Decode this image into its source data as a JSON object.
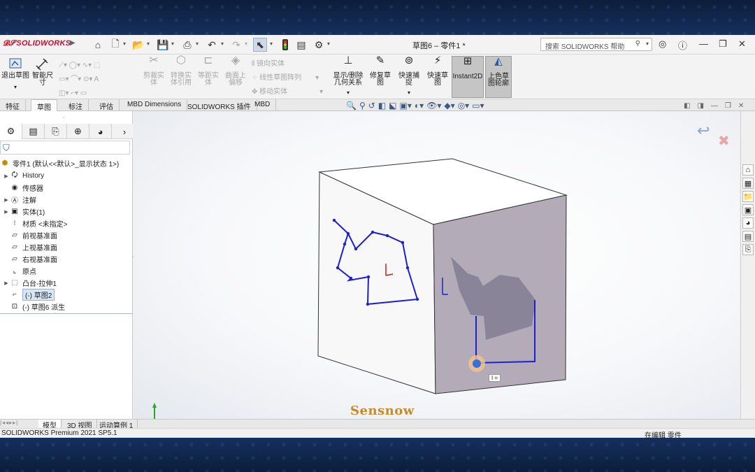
{
  "app": {
    "brand": "SOLIDWORKS",
    "doc_title": "草图6 – 零件1 *",
    "search_placeholder": "搜索 SOLIDWORKS 帮助"
  },
  "ribbon": {
    "exit_sketch": "退出草图",
    "smart_dim": "智能尺寸",
    "trim": "剪裁实体",
    "convert": "转换实体引用",
    "offset": "等距实体",
    "surface_offset": "曲面上偏移",
    "mirror": "镜向实体",
    "linear_pattern": "线性草图阵列",
    "move": "移动实体",
    "show_delete": "显示/删除几何关系",
    "repair": "修复草图",
    "quick_snap": "快速捕捉",
    "rapid_sketch": "快速草图",
    "instant2d": "Instant2D",
    "shaded_sketch": "上色草图轮廓"
  },
  "tabs": [
    "特征",
    "草图",
    "标注",
    "评估",
    "MBD Dimensions",
    "SOLIDWORKS 插件",
    "MBD"
  ],
  "active_tab": "草图",
  "tree": {
    "root": "零件1 (默认<<默认>_显示状态 1>)",
    "items": [
      "History",
      "传感器",
      "注解",
      "实体(1)",
      "材质 <未指定>",
      "前视基准面",
      "上视基准面",
      "右视基准面",
      "原点",
      "凸台-拉伸1",
      "(-) 草图2",
      "(-) 草图6 派生"
    ]
  },
  "watermark": "Sensnow",
  "dim_label": "I =",
  "bottom_tabs": [
    "模型",
    "3D 视图",
    "运动算例 1"
  ],
  "status": {
    "version": "SOLIDWORKS Premium 2021 SP5.1",
    "mode": "在编辑 零件"
  },
  "colors": {
    "sketch": "#1e1ed2",
    "selected_face": "#b3acb8",
    "region": "#8a8499",
    "origin": "#cc1a1a",
    "accent": "#c8102e"
  }
}
